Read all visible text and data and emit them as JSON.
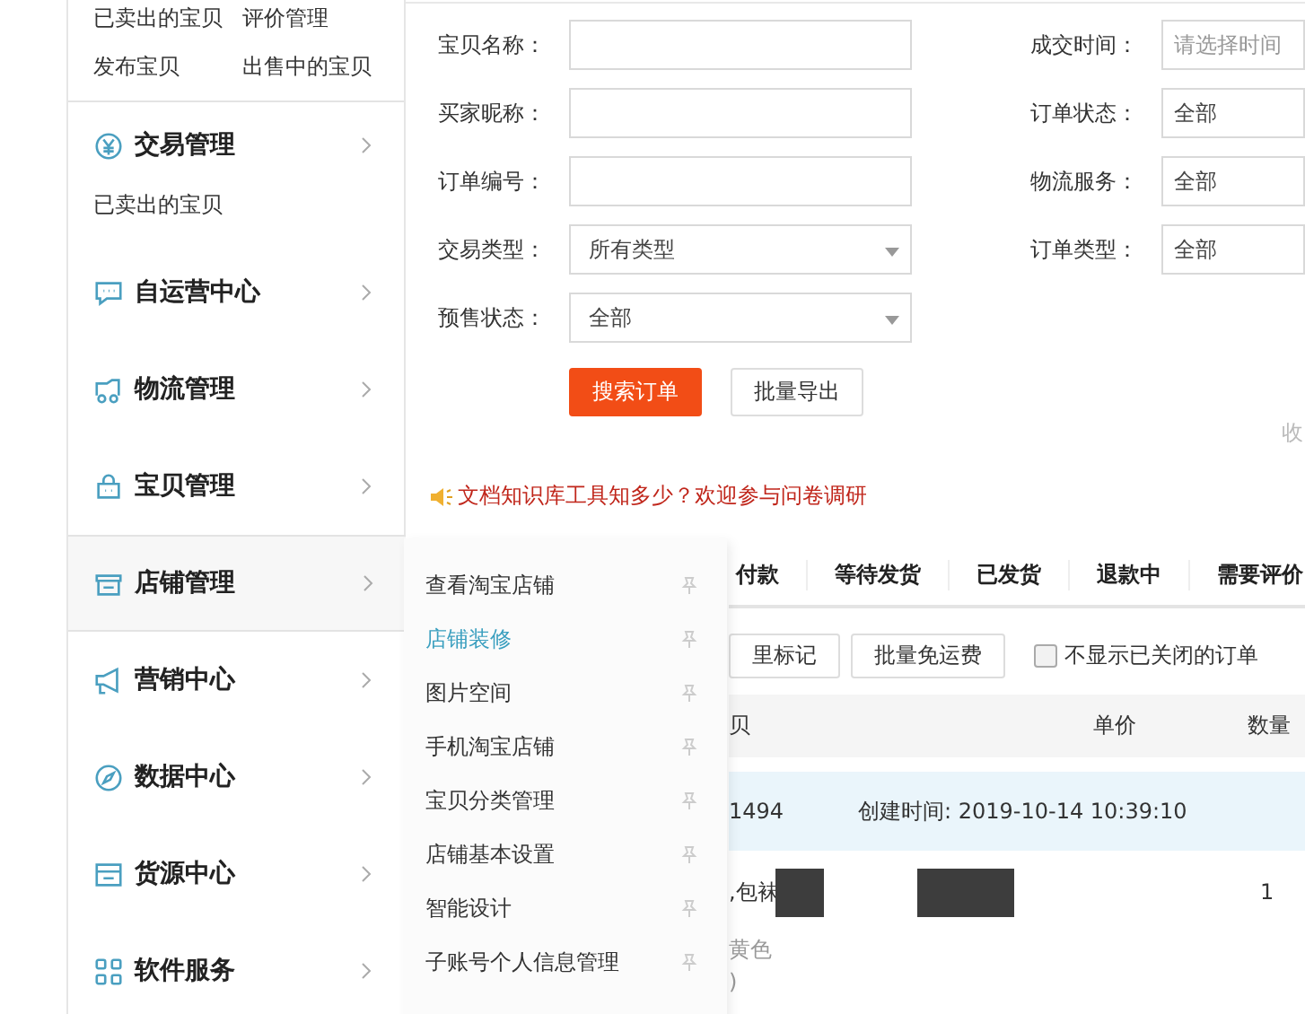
{
  "sidebar": {
    "quick_links": [
      "已卖出的宝贝",
      "评价管理",
      "发布宝贝",
      "出售中的宝贝"
    ],
    "groups": [
      {
        "title": "交易管理",
        "selected": false,
        "children": [
          "已卖出的宝贝"
        ]
      },
      {
        "title": "自运营中心",
        "selected": false
      },
      {
        "title": "物流管理",
        "selected": false
      },
      {
        "title": "宝贝管理",
        "selected": false
      },
      {
        "title": "店铺管理",
        "selected": true
      },
      {
        "title": "营销中心",
        "selected": false
      },
      {
        "title": "数据中心",
        "selected": false
      },
      {
        "title": "货源中心",
        "selected": false
      },
      {
        "title": "软件服务",
        "selected": false
      }
    ]
  },
  "flyout": {
    "items": [
      {
        "label": "查看淘宝店铺",
        "selected": false
      },
      {
        "label": "店铺装修",
        "selected": true
      },
      {
        "label": "图片空间",
        "selected": false
      },
      {
        "label": "手机淘宝店铺",
        "selected": false
      },
      {
        "label": "宝贝分类管理",
        "selected": false
      },
      {
        "label": "店铺基本设置",
        "selected": false
      },
      {
        "label": "智能设计",
        "selected": false
      },
      {
        "label": "子账号个人信息管理",
        "selected": false
      }
    ]
  },
  "search_form": {
    "left_fields": [
      {
        "label": "宝贝名称：",
        "kind": "text"
      },
      {
        "label": "买家昵称：",
        "kind": "text"
      },
      {
        "label": "订单编号：",
        "kind": "text"
      },
      {
        "label": "交易类型：",
        "kind": "select",
        "value": "所有类型"
      },
      {
        "label": "预售状态：",
        "kind": "select",
        "value": "全部"
      }
    ],
    "right_fields": [
      {
        "label": "成交时间：",
        "kind": "date",
        "placeholder": "请选择时间"
      },
      {
        "label": "订单状态：",
        "kind": "select",
        "value": "全部"
      },
      {
        "label": "物流服务：",
        "kind": "select",
        "value": "全部"
      },
      {
        "label": "订单类型：",
        "kind": "select",
        "value": "全部"
      }
    ],
    "search_button": "搜索订单",
    "export_button": "批量导出",
    "collapse_link": "收"
  },
  "notice": "文档知识库工具知多少？欢迎参与问卷调研",
  "status_tabs": [
    "付款",
    "等待发货",
    "已发货",
    "退款中",
    "需要评价"
  ],
  "batch_buttons": [
    "里标记",
    "批量免运费"
  ],
  "hide_closed": {
    "label": "不显示已关闭的订单",
    "checked": false
  },
  "table": {
    "columns": [
      "贝",
      "单价",
      "数量"
    ],
    "order": {
      "number": "1494",
      "created": "创建时间: 2019-10-14 10:39:10"
    },
    "item": {
      "title": ",包袜",
      "quantity": "1",
      "detail_lines": [
        "黄色",
        ")"
      ]
    }
  }
}
